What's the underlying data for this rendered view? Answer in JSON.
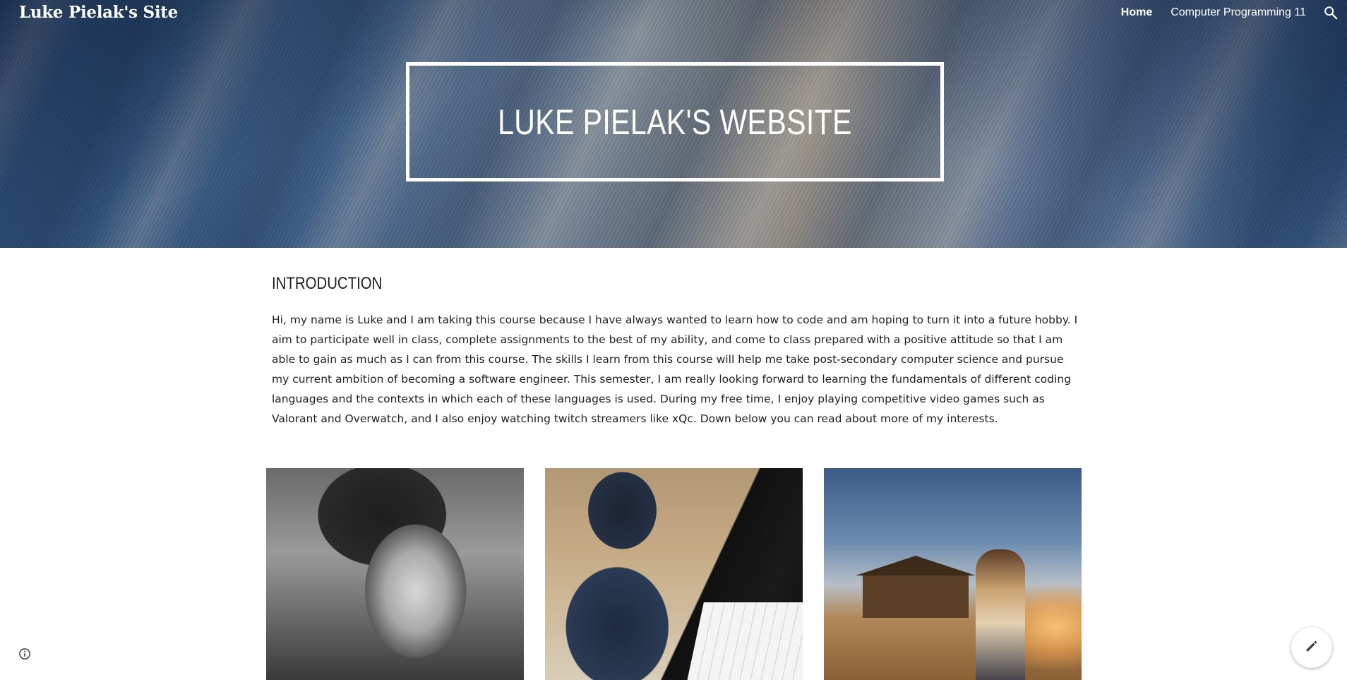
{
  "header": {
    "site_title": "Luke Pielak's Site",
    "nav": [
      {
        "label": "Home",
        "active": true
      },
      {
        "label": "Computer Programming 11",
        "active": false
      }
    ],
    "search_icon": "search-icon"
  },
  "hero": {
    "heading": "LUKE PIELAK'S WEBSITE"
  },
  "intro": {
    "title": "INTRODUCTION",
    "body": "Hi, my name is Luke and I am taking this course because I have always wanted to learn how to code and am hoping to turn it into a future hobby. I aim to participate well in class, complete assignments to the best of my ability, and come to class prepared with a positive attitude so that I am able to gain as much as I can from this course. The skills I learn from this course will help me take post-secondary computer science and pursue my current ambition of becoming a software engineer. This semester, I am really looking forward to learning the fundamentals of different coding languages and the contexts in which each of these languages is used. During my free time, I enjoy playing competitive video games such as Valorant and Overwatch, and I also enjoy watching twitch streamers like xQc. Down below you can read about more of my interests."
  },
  "images": [
    {
      "name": "portrait-image"
    },
    {
      "name": "piano-image"
    },
    {
      "name": "movie-image"
    }
  ],
  "icons": {
    "info": "info-icon",
    "edit": "pencil-icon"
  }
}
